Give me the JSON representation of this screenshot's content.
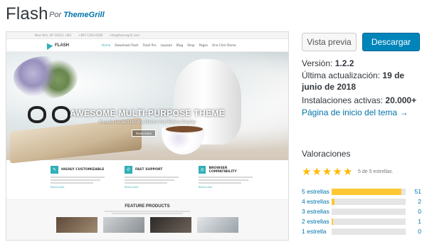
{
  "header": {
    "theme_name": "Flash",
    "author_prefix": "Por",
    "author_name": "ThemeGrill"
  },
  "preview": {
    "topbar": [
      "New York, NY 10012, USA",
      "+897-1263-6586",
      "info@themegrill.com"
    ],
    "logo_text": "FLASH",
    "menu": [
      "Home",
      "Download Flash",
      "Flash Pro",
      "Layouts",
      "Blog",
      "Shop",
      "Pages",
      "One Click Demo"
    ],
    "hero_title": "AWESOME MULTI-PURPOSE THEME",
    "hero_subtitle": "It Looks Perfect On Any Device And Retina Display",
    "hero_button": "Read more",
    "features": [
      {
        "title": "HIGHLY CUSTOMIZABLE",
        "more": "Read more"
      },
      {
        "title": "FAST SUPPORT",
        "more": "Read more"
      },
      {
        "title": "BROWSER COMPATIBILITY",
        "more": "Read more"
      }
    ],
    "products_title": "FEATURE PRODUCTS"
  },
  "actions": {
    "preview_label": "Vista previa",
    "download_label": "Descargar"
  },
  "meta": {
    "version_label": "Versión:",
    "version_value": "1.2.2",
    "updated_label": "Última actualización:",
    "updated_value": "19 de junio de 2018",
    "installs_label": "Instalaciones activas:",
    "installs_value": "20.000+",
    "homepage_link": "Página de inicio del tema →"
  },
  "ratings": {
    "title": "Valoraciones",
    "summary": "5 de 5 estrellas.",
    "stars": 5,
    "rows": [
      {
        "label": "5 estrellas",
        "count": "51",
        "fraction": 0.94
      },
      {
        "label": "4 estrellas",
        "count": "2",
        "fraction": 0.04
      },
      {
        "label": "3 estrellas",
        "count": "0",
        "fraction": 0
      },
      {
        "label": "2 estrellas",
        "count": "1",
        "fraction": 0.02
      },
      {
        "label": "1 estrella",
        "count": "0",
        "fraction": 0
      }
    ]
  },
  "colors": {
    "accent": "#0085ba",
    "link": "#0073aa",
    "star": "#ffb900",
    "bar_fill": "#ffc733",
    "theme_accent": "#30afb8"
  }
}
